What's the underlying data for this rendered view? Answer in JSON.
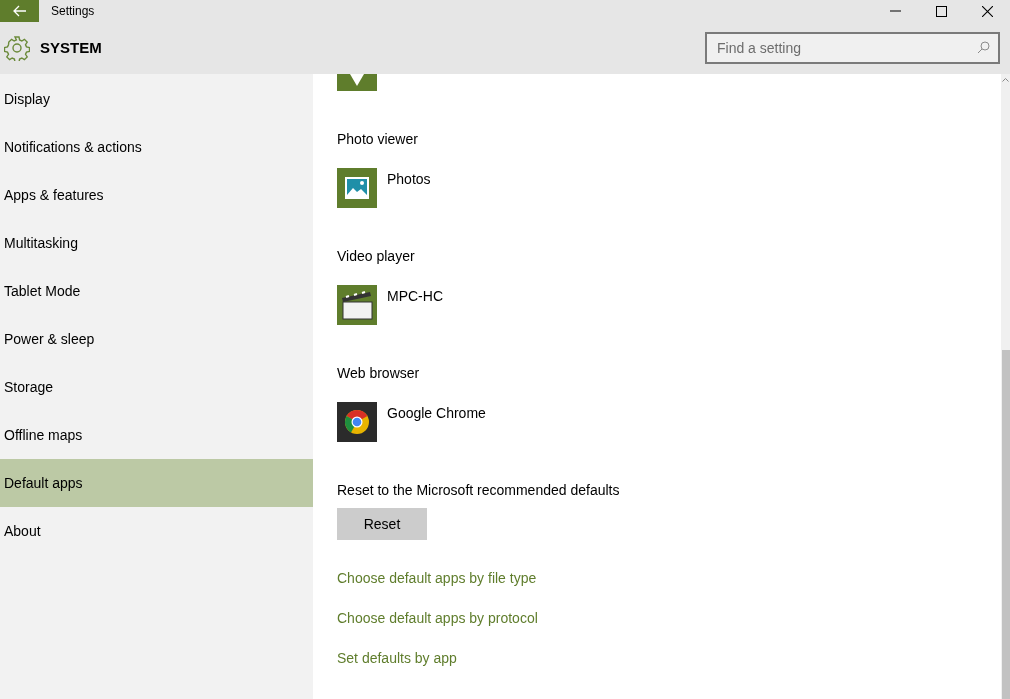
{
  "window": {
    "title": "Settings"
  },
  "header": {
    "title": "SYSTEM",
    "search": {
      "placeholder": "Find a setting"
    }
  },
  "sidebar": {
    "items": [
      {
        "label": "Display",
        "selected": false
      },
      {
        "label": "Notifications & actions",
        "selected": false
      },
      {
        "label": "Apps & features",
        "selected": false
      },
      {
        "label": "Multitasking",
        "selected": false
      },
      {
        "label": "Tablet Mode",
        "selected": false
      },
      {
        "label": "Power & sleep",
        "selected": false
      },
      {
        "label": "Storage",
        "selected": false
      },
      {
        "label": "Offline maps",
        "selected": false
      },
      {
        "label": "Default apps",
        "selected": true
      },
      {
        "label": "About",
        "selected": false
      }
    ]
  },
  "default_apps": [
    {
      "category": "Photo viewer",
      "app": "Photos",
      "kind": "photos"
    },
    {
      "category": "Video player",
      "app": "MPC-HC",
      "kind": "clapper"
    },
    {
      "category": "Web browser",
      "app": "Google Chrome",
      "kind": "chrome"
    }
  ],
  "reset": {
    "label": "Reset to the Microsoft recommended defaults",
    "button": "Reset"
  },
  "links": [
    "Choose default apps by file type",
    "Choose default apps by protocol",
    "Set defaults by app"
  ]
}
